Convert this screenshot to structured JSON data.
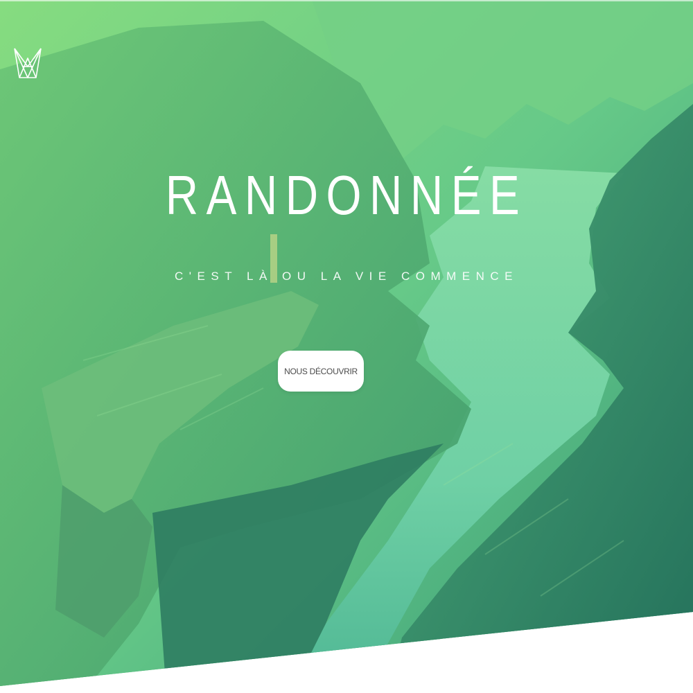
{
  "hero": {
    "title": "RANDONNÉE",
    "subtitle": "C'EST LÀ OU LA VIE COMMENCE",
    "cta_label": "NOUS DÉCOUVRIR",
    "logo_icon": "crown-logo-icon"
  },
  "colors": {
    "gradient_start": "#7ed77e",
    "gradient_mid": "#5cc185",
    "gradient_end": "#2f8f6f",
    "button_bg": "#ffffff",
    "button_text": "#4a4a4a"
  }
}
